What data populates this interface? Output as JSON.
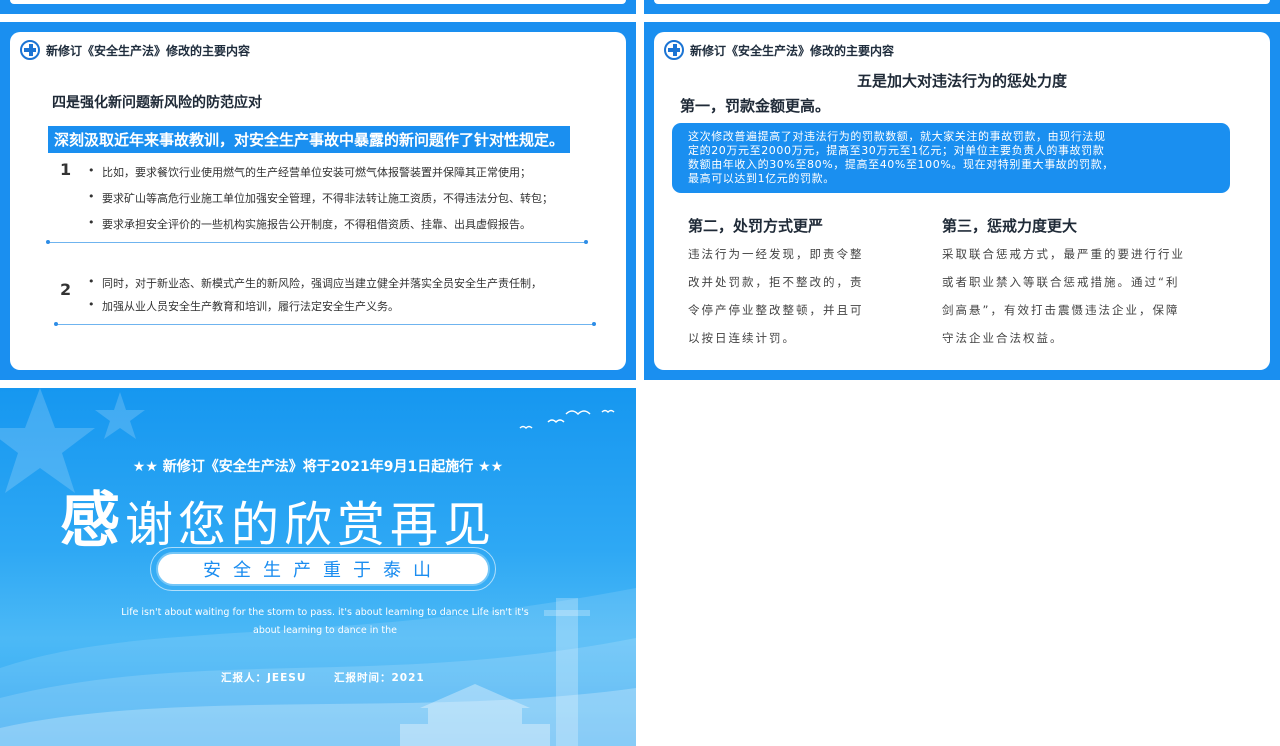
{
  "slide1": {
    "header": "新修订《安全生产法》修改的主要内容",
    "title": "四是强化新问题新风险的防范应对",
    "band": "深刻汲取近年来事故教训，对安全生产事故中暴露的新问题作了针对性规定。",
    "section1": {
      "num": "1",
      "bullets": [
        "比如，要求餐饮行业使用燃气的生产经营单位安装可燃气体报警装置并保障其正常使用；",
        "要求矿山等高危行业施工单位加强安全管理，不得非法转让施工资质，不得违法分包、转包；",
        "要求承担安全评价的一些机构实施报告公开制度，不得租借资质、挂靠、出具虚假报告。"
      ]
    },
    "section2": {
      "num": "2",
      "line1": "同时，对于新业态、新模式产生的新风险，强调应当建立健全并落实全员安全生产责任制，",
      "line2": "加强从业人员安全生产教育和培训，履行法定安全生产义务。"
    }
  },
  "slide2": {
    "header": "新修订《安全生产法》修改的主要内容",
    "title": "五是加大对违法行为的惩处力度",
    "sub": "第一，罚款金额更高。",
    "box_lines": [
      "这次修改普遍提高了对违法行为的罚款数额，就大家关注的事故罚款，由现行法规",
      "定的20万元至2000万元，提高至30万元至1亿元；对单位主要负责人的事故罚款",
      "数额由年收入的30%至80%，提高至40%至100%。现在对特别重大事故的罚款，",
      "最高可以达到1亿元的罚款。"
    ],
    "col1": {
      "title": "第二，处罚方式更严",
      "lines": [
        "违法行为一经发现，即责令整",
        "改并处罚款，拒不整改的，责",
        "令停产停业整改整顿，并且可",
        "以按日连续计罚。"
      ]
    },
    "col2": {
      "title": "第三，惩戒力度更大",
      "lines": [
        "采取联合惩戒方式，最严重的要进行行业",
        "或者职业禁入等联合惩戒措施。通过“利",
        "剑高悬”，有效打击震慑违法企业，保障",
        "守法企业合法权益。"
      ]
    }
  },
  "slide3": {
    "stars_text": "★★ 新修订《安全生产法》将于2021年9月1日起施行 ★★",
    "big_first": "感",
    "big_rest": "谢您的欣赏再见",
    "pill": "安全生产重于泰山",
    "eng_line1": "Life isn't about waiting for the storm to pass. it's about learning to dance Life isn't it's",
    "eng_line2": "about learning to dance in the",
    "reporter": "汇报人：JEESU",
    "time": "汇报时间：2021"
  },
  "colors": {
    "primary": "#1a8ff0",
    "text_dark": "#1f2a37"
  }
}
